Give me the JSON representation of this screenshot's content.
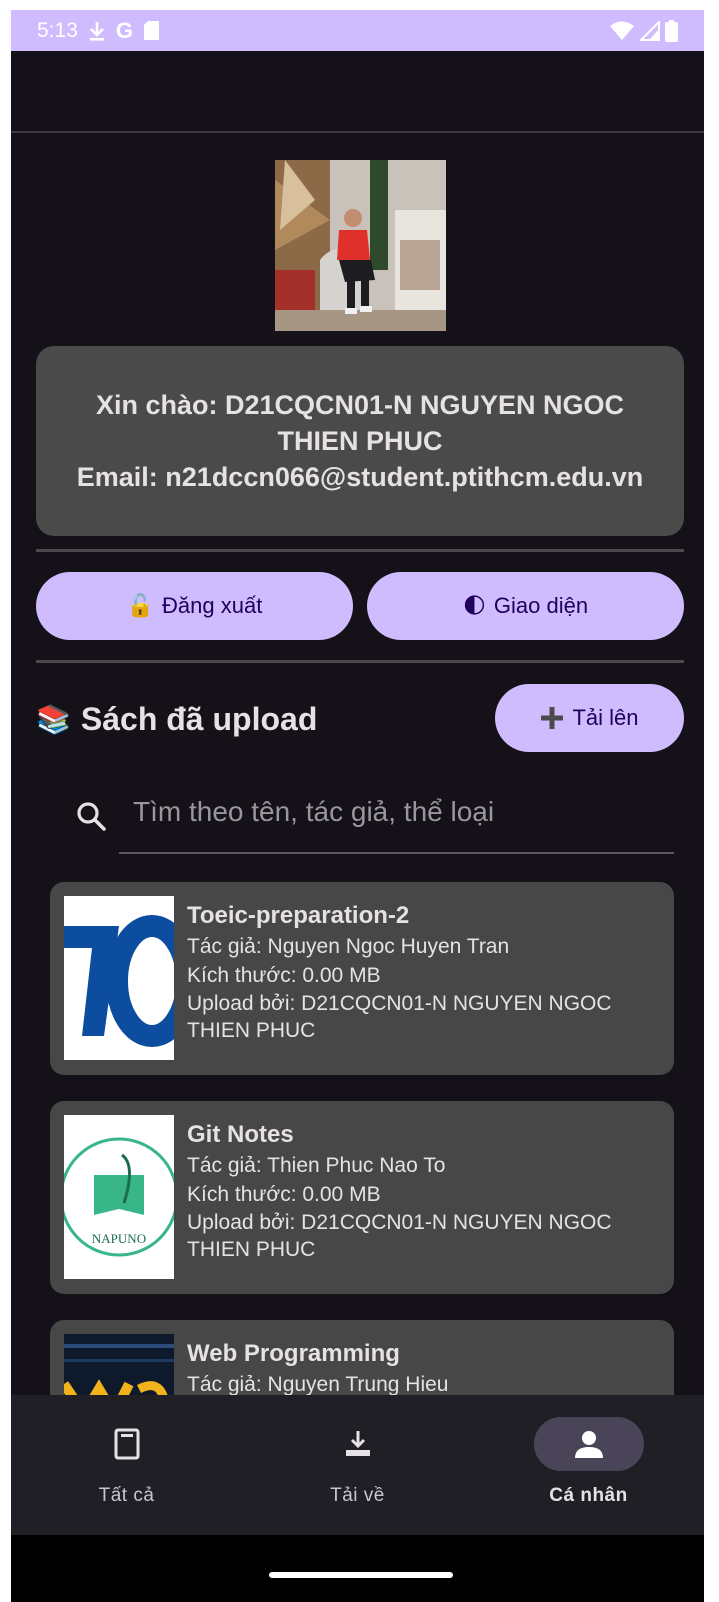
{
  "status_bar": {
    "time": "5:13",
    "icons_left": [
      "download-icon",
      "google-icon",
      "sd-card-icon"
    ],
    "icons_right": [
      "wifi-icon",
      "signal-icon",
      "battery-icon"
    ],
    "color": "#cfbcff"
  },
  "profile": {
    "greeting": "Xin chào: D21CQCN01-N NGUYEN NGOC THIEN PHUC",
    "email": "Email: n21dccn066@student.ptithcm.edu.vn"
  },
  "actions": {
    "logout_icon": "🔓",
    "logout_label": "Đăng xuất",
    "theme_icon": "🌓",
    "theme_label": "Giao diện"
  },
  "uploads": {
    "icon": "📚",
    "title": "Sách đã upload",
    "upload_button_label": "Tải lên",
    "search_placeholder": "Tìm theo tên, tác giả, thể loại"
  },
  "books": [
    {
      "title": "Toeic-preparation-2",
      "author": "Tác giả: Nguyen Ngoc Huyen Tran",
      "size": "Kích thước: 0.00 MB",
      "uploader": "Upload bởi: D21CQCN01-N NGUYEN NGOC THIEN PHUC",
      "thumb": "toeic-cover"
    },
    {
      "title": "Git Notes",
      "author": "Tác giả: Thien Phuc Nao To",
      "size": "Kích thước: 0.00 MB",
      "uploader": "Upload bởi: D21CQCN01-N NGUYEN NGOC THIEN PHUC",
      "thumb": "napuno-cover",
      "thumb_text": "NAPUNO"
    },
    {
      "title": "Web Programming",
      "author": "Tác giả: Nguyen Trung Hieu",
      "size": "",
      "uploader": "",
      "thumb": "web-cover"
    }
  ],
  "bottom_nav": {
    "items": [
      {
        "label": "Tất cả",
        "icon": "book-icon",
        "active": false
      },
      {
        "label": "Tải về",
        "icon": "download-tray-icon",
        "active": false
      },
      {
        "label": "Cá nhân",
        "icon": "person-icon",
        "active": true
      }
    ]
  },
  "colors": {
    "background": "#141218",
    "card": "#474747",
    "accent": "#cfbcff",
    "nav_background": "#211f26",
    "nav_indicator": "#4a4458"
  }
}
